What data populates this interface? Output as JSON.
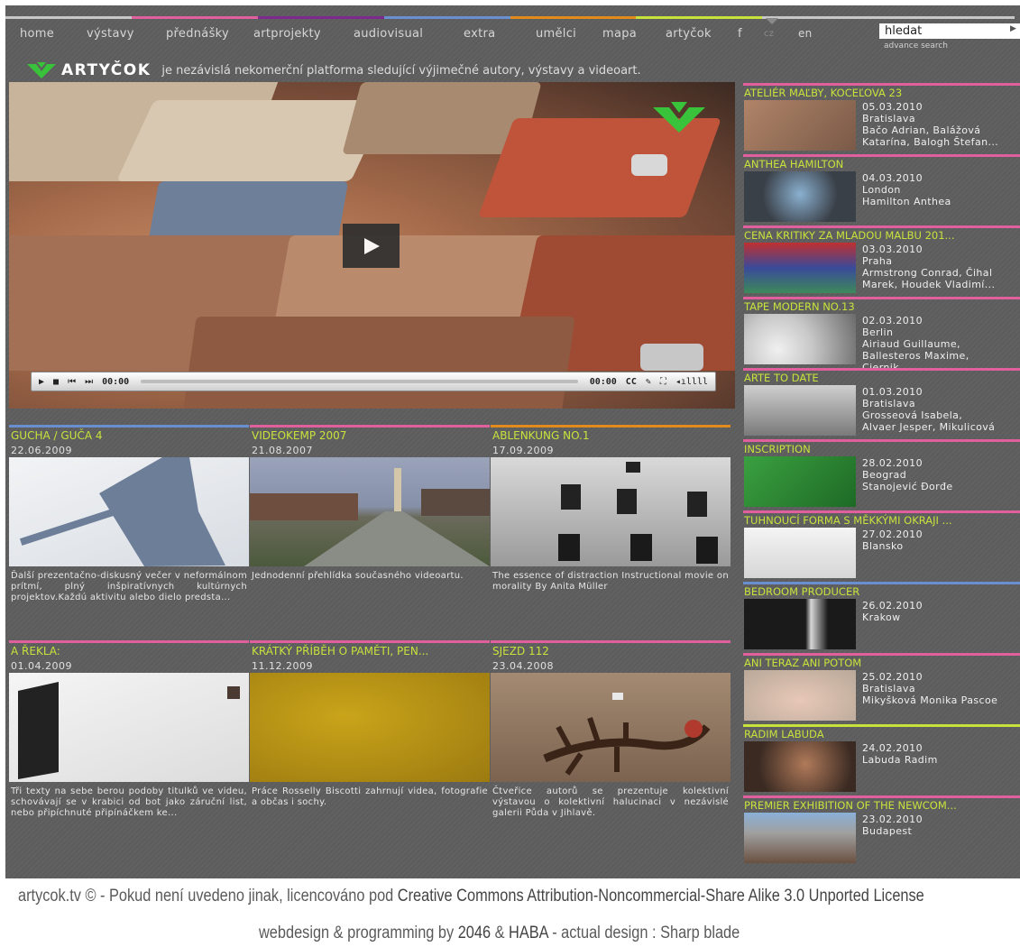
{
  "nav": {
    "items": [
      "home",
      "výstavy",
      "přednášky",
      "artprojekty",
      "audiovisual",
      "extra",
      "umělci",
      "mapa",
      "artyčok",
      "f",
      "cz",
      "en"
    ]
  },
  "search": {
    "value": "hledat",
    "advance": "advance search"
  },
  "brand": {
    "name": "ARTYČOK",
    "tagline": "je nezávislá nekomerční platforma sledující výjimečné autory, výstavy a videoart."
  },
  "player": {
    "time_current": "00:00",
    "time_total": "00:00",
    "cc_label": "CC"
  },
  "colors": {
    "pink": "#e0609e",
    "purple": "#7d2a8c",
    "blue": "#6a8fd0",
    "orange": "#e08b1c",
    "yellow": "#c8e23c",
    "accent_green": "#39c33a"
  },
  "grid": [
    {
      "title": "GUCHA / GUČA 4",
      "date": "22.06.2009",
      "desc": "Ďalší prezentačno-diskusný večer v neformálnom prítmí, plný inšpiratívnych kultúrnych projektov.Každú aktivitu alebo dielo predsta..."
    },
    {
      "title": "VIDEOKEMP 2007",
      "date": "21.08.2007",
      "desc": "Jednodenní přehlídka současného videoartu."
    },
    {
      "title": "ABLENKUNG NO.1",
      "date": "17.09.2009",
      "desc": "The essence of distraction Instructional movie on morality By Anita Müller"
    },
    {
      "title": "A ŘEKLA:",
      "date": "01.04.2009",
      "desc": "Tři texty na sebe berou podoby titulků ve videu, schovávají se v krabici od bot jako záruční list, nebo připíchnuté připínáčkem ke..."
    },
    {
      "title": "KRÁTKÝ PŘÍBĚH O PAMĚTI, PEN...",
      "date": "11.12.2009",
      "desc": "Práce Rosselly Biscotti zahrnují videa, fotografie a občas i sochy."
    },
    {
      "title": "SJEZD 112",
      "date": "23.04.2008",
      "desc": "Čtveřice autorů se prezentuje kolektivní výstavou o kolektivní halucinaci v nezávislé galerii Půda v Jihlavě."
    }
  ],
  "sidebar": [
    {
      "title": "ATELIÉR MAĽBY, KOCEĽOVA 23",
      "date": "05.03.2010",
      "lines": [
        "Bratislava",
        "Bačo Adrian, Balážová",
        "Katarína, Balogh Štefan..."
      ]
    },
    {
      "title": "ANTHEA HAMILTON",
      "date": "04.03.2010",
      "lines": [
        "London",
        "Hamilton Anthea"
      ]
    },
    {
      "title": "CENA KRITIKY ZA MLADOU MALBU 201...",
      "date": "03.03.2010",
      "lines": [
        "Praha",
        "Armstrong Conrad, Čihal",
        "Marek, Houdek Vladimí..."
      ]
    },
    {
      "title": "TAPE MODERN NO.13",
      "date": "02.03.2010",
      "lines": [
        "Berlin",
        "Airiaud Guillaume,",
        "Ballesteros Maxime,",
        "Ciernik"
      ]
    },
    {
      "title": "ARTE TO DATE",
      "date": "01.03.2010",
      "lines": [
        "Bratislava",
        "Grosseová Isabela,",
        "Alvaer Jesper, Mikulicová"
      ]
    },
    {
      "title": "INSCRIPTION",
      "date": "28.02.2010",
      "lines": [
        "Beograd",
        "Stanojević Đorđe"
      ]
    },
    {
      "title": "TUHNOUCÍ FORMA S MĚKKÝMI OKRAJI ...",
      "date": "27.02.2010",
      "lines": [
        "Blansko"
      ]
    },
    {
      "title": "BEDROOM PRODUCER",
      "date": "26.02.2010",
      "lines": [
        "Krakow"
      ]
    },
    {
      "title": "ANI TERAZ ANI POTOM",
      "date": "25.02.2010",
      "lines": [
        "Bratislava",
        "Mikyšková Monika Pascoe"
      ]
    },
    {
      "title": "RADIM LABUDA",
      "date": "24.02.2010",
      "lines": [
        "Labuda Radim"
      ]
    },
    {
      "title": "PREMIER EXHIBITION OF THE NEWCOM...",
      "date": "23.02.2010",
      "lines": [
        "Budapest"
      ]
    }
  ],
  "footer": {
    "line1_prefix": "artycok.tv © - Pokud není uvedeno jinak, licencováno pod ",
    "line1_link": "Creative Commons Attribution-Noncommercial-Share Alike 3.0 Unported License",
    "line2_prefix": "webdesign & programming by ",
    "line2_link1": "2046",
    "line2_mid": " & ",
    "line2_link2": "HABA",
    "line2_suffix": " - actual design : Sharp blade"
  }
}
